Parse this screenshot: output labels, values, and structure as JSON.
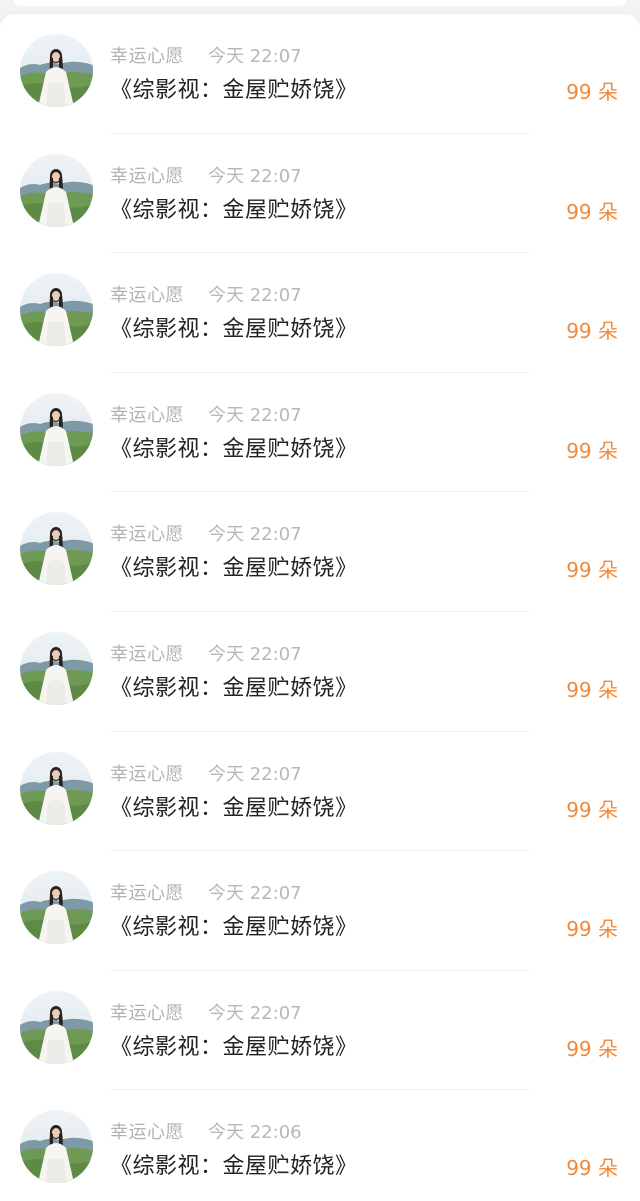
{
  "colors": {
    "background": "#f3f3f3",
    "card": "#ffffff",
    "name_text": "#b3b3b3",
    "time_text": "#b8b8b8",
    "message_text": "#222222",
    "amount_accent": "#f0893a"
  },
  "records": [
    {
      "name": "幸运心愿",
      "time": "今天 22:07",
      "message": "《综影视：金屋贮娇饶》",
      "amount": "99 朵",
      "avatar_icon": "user-avatar-photo"
    },
    {
      "name": "幸运心愿",
      "time": "今天 22:07",
      "message": "《综影视：金屋贮娇饶》",
      "amount": "99 朵",
      "avatar_icon": "user-avatar-photo"
    },
    {
      "name": "幸运心愿",
      "time": "今天 22:07",
      "message": "《综影视：金屋贮娇饶》",
      "amount": "99 朵",
      "avatar_icon": "user-avatar-photo"
    },
    {
      "name": "幸运心愿",
      "time": "今天 22:07",
      "message": "《综影视：金屋贮娇饶》",
      "amount": "99 朵",
      "avatar_icon": "user-avatar-photo"
    },
    {
      "name": "幸运心愿",
      "time": "今天 22:07",
      "message": "《综影视：金屋贮娇饶》",
      "amount": "99 朵",
      "avatar_icon": "user-avatar-photo"
    },
    {
      "name": "幸运心愿",
      "time": "今天 22:07",
      "message": "《综影视：金屋贮娇饶》",
      "amount": "99 朵",
      "avatar_icon": "user-avatar-photo"
    },
    {
      "name": "幸运心愿",
      "time": "今天 22:07",
      "message": "《综影视：金屋贮娇饶》",
      "amount": "99 朵",
      "avatar_icon": "user-avatar-photo"
    },
    {
      "name": "幸运心愿",
      "time": "今天 22:07",
      "message": "《综影视：金屋贮娇饶》",
      "amount": "99 朵",
      "avatar_icon": "user-avatar-photo"
    },
    {
      "name": "幸运心愿",
      "time": "今天 22:07",
      "message": "《综影视：金屋贮娇饶》",
      "amount": "99 朵",
      "avatar_icon": "user-avatar-photo"
    },
    {
      "name": "幸运心愿",
      "time": "今天 22:06",
      "message": "《综影视：金屋贮娇饶》",
      "amount": "99 朵",
      "avatar_icon": "user-avatar-photo"
    }
  ]
}
